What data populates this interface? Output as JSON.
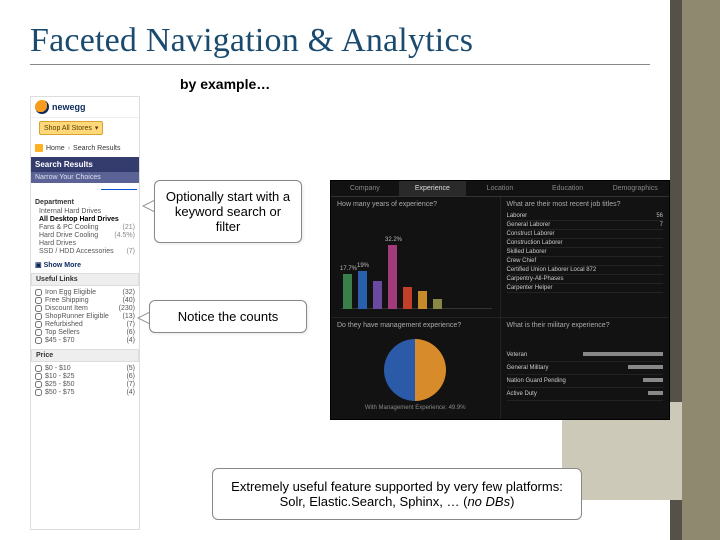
{
  "title": "Faceted Navigation & Analytics",
  "subtitle": "by example…",
  "callouts": {
    "0": "Optionally start with a keyword search or filter",
    "1": "Notice the counts",
    "2a": "Extremely useful feature supported by very few platforms: Solr, Elastic.Search, Sphinx, … (",
    "2b": "no DBs",
    "2c": ")"
  },
  "shot": {
    "logo": "newegg",
    "shop_all": "Shop All Stores",
    "home": "Home",
    "crumb": "Search Results",
    "sr_header": "Search Results",
    "narrow": "Narrow Your Choices",
    "dept_head": "Department",
    "depts": [
      {
        "label": "Internal Hard Drives"
      },
      {
        "label": "All Desktop Hard Drives"
      },
      {
        "label": "Fans & PC Cooling",
        "count": "(21)"
      },
      {
        "label": "Hard Drive Cooling",
        "count": "(4.5%)"
      },
      {
        "label": "Hard Drives"
      },
      {
        "label": "SSD / HDD Accessories",
        "count": "(7)"
      }
    ],
    "show_more": "Show More",
    "useful_head": "Useful Links",
    "useful": [
      {
        "label": "Iron Egg Eligible",
        "count": "(32)"
      },
      {
        "label": "Free Shipping",
        "count": "(40)"
      },
      {
        "label": "Discount Item",
        "count": "(230)"
      },
      {
        "label": "ShopRunner Eligible",
        "count": "(13)"
      },
      {
        "label": "Refurbished",
        "count": "(7)"
      },
      {
        "label": "Top Sellers",
        "count": "(6)"
      },
      {
        "label": "$45 - $70",
        "count": "(4)"
      }
    ],
    "price_head": "Price",
    "price": [
      {
        "label": "$0 - $10",
        "count": "(5)"
      },
      {
        "label": "$10 - $25",
        "count": "(6)"
      },
      {
        "label": "$25 - $50",
        "count": "(7)"
      },
      {
        "label": "$50 - $75",
        "count": "(4)"
      }
    ]
  },
  "dash": {
    "tabs": [
      "Company",
      "Experience",
      "Location",
      "Education",
      "Demographics"
    ],
    "panel1": {
      "title": "How many years of experience?"
    },
    "panel2": {
      "title": "What are their most recent job titles?"
    },
    "panel3": {
      "title": "Do they have management experience?",
      "label": "With Management Experience: 49.9%"
    },
    "panel4": {
      "title": "What is their military experience?"
    }
  },
  "chart_data": {
    "bar": {
      "type": "bar",
      "title": "How many years of experience?",
      "percent_axis_max": 40,
      "series": [
        {
          "label": "17.7%",
          "value": 17.7,
          "color": "#3a7f4a"
        },
        {
          "label": "19%",
          "value": 19.0,
          "color": "#2a5fae"
        },
        {
          "label": "",
          "value": 14.0,
          "color": "#6a4aa0"
        },
        {
          "label": "32.2%",
          "value": 32.2,
          "color": "#a33a7a"
        },
        {
          "label": "",
          "value": 11.0,
          "color": "#c2402a"
        },
        {
          "label": "",
          "value": 9.0,
          "color": "#c78a2a"
        },
        {
          "label": "",
          "value": 5.0,
          "color": "#888844"
        }
      ]
    },
    "jobs": {
      "type": "table",
      "title": "What are their most recent job titles?",
      "rows": [
        {
          "name": "Laborer",
          "n": "56"
        },
        {
          "name": "General Laborer",
          "n": "7"
        },
        {
          "name": "Construct Laborer",
          "n": ""
        },
        {
          "name": "Construction Laborer",
          "n": ""
        },
        {
          "name": "Skilled Laborer",
          "n": ""
        },
        {
          "name": "Crew Chief",
          "n": ""
        },
        {
          "name": "Certified Union Laborer Local 872",
          "n": ""
        },
        {
          "name": "Carpentry-All-Phases",
          "n": ""
        },
        {
          "name": "Carpenter Helper",
          "n": ""
        }
      ]
    },
    "pie": {
      "type": "pie",
      "title": "Do they have management experience?",
      "slices": [
        {
          "name": "With Management Experience",
          "value": 49.9,
          "color": "#d88b2a"
        },
        {
          "name": "Without",
          "value": 50.1,
          "color": "#2a5aa8"
        }
      ]
    },
    "military": {
      "type": "bar",
      "title": "What is their military experience?",
      "rows": [
        {
          "name": "Veteran",
          "value": 80
        },
        {
          "name": "General Military",
          "value": 35
        },
        {
          "name": "Nation Guard Pending",
          "value": 20
        },
        {
          "name": "Active Duty",
          "value": 15
        }
      ]
    }
  }
}
